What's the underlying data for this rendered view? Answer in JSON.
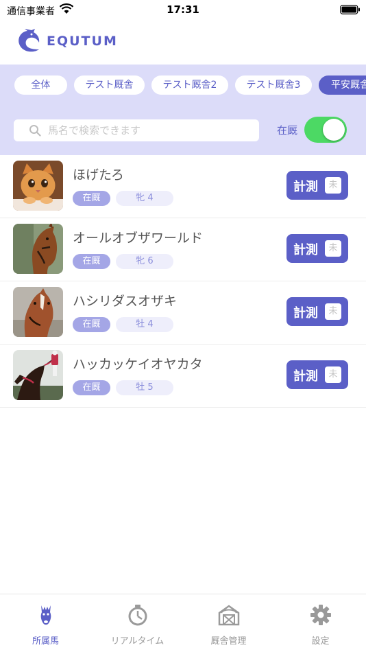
{
  "status_bar": {
    "carrier": "通信事業者",
    "time": "17:31"
  },
  "header": {
    "brand": "EQUTUM"
  },
  "stable_filters": [
    {
      "label": "全体",
      "active": false
    },
    {
      "label": "テスト厩舎",
      "active": false
    },
    {
      "label": "テスト厩舎2",
      "active": false
    },
    {
      "label": "テスト厩舎3",
      "active": false
    },
    {
      "label": "平安厩舎",
      "active": true
    }
  ],
  "search": {
    "placeholder": "馬名で検索できます",
    "value": ""
  },
  "in_stable_toggle": {
    "label": "在厩",
    "on": true
  },
  "horses": [
    {
      "name": "ほげたろ",
      "status": "在厩",
      "sex_age": "牝 4",
      "measure_label": "計測",
      "measure_badge": "未",
      "photo_icon": "cat-photo"
    },
    {
      "name": "オールオブザワールド",
      "status": "在厩",
      "sex_age": "牝 6",
      "measure_label": "計測",
      "measure_badge": "未",
      "photo_icon": "horse-photo"
    },
    {
      "name": "ハシリダスオザキ",
      "status": "在厩",
      "sex_age": "牡 4",
      "measure_label": "計測",
      "measure_badge": "未",
      "photo_icon": "horse-photo"
    },
    {
      "name": "ハッカッケイオヤカタ",
      "status": "在厩",
      "sex_age": "牡 5",
      "measure_label": "計測",
      "measure_badge": "未",
      "photo_icon": "racing-horse-photo"
    }
  ],
  "tabs": [
    {
      "label": "所属馬",
      "icon": "horse-head-icon",
      "active": true
    },
    {
      "label": "リアルタイム",
      "icon": "stopwatch-icon",
      "active": false
    },
    {
      "label": "厩舎管理",
      "icon": "barn-icon",
      "active": false
    },
    {
      "label": "設定",
      "icon": "gear-icon",
      "active": false
    }
  ],
  "colors": {
    "accent": "#5b5fc7",
    "filter_bg": "#dcdcf9",
    "toggle_on": "#4cd964"
  }
}
